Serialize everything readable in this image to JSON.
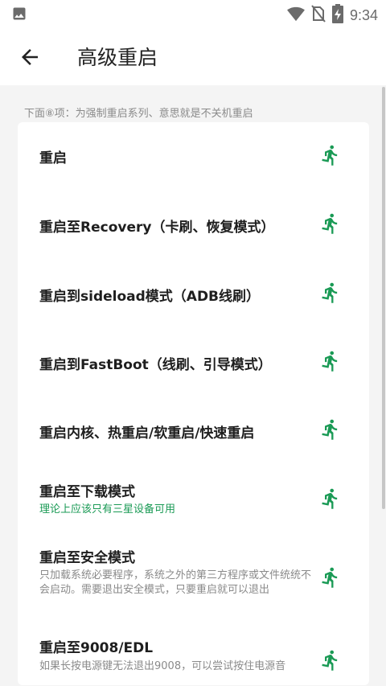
{
  "status_bar": {
    "time": "9:34",
    "icons": [
      "image-icon",
      "wifi-icon",
      "no-sim-icon",
      "battery-charging-icon"
    ]
  },
  "app_bar": {
    "title": "高级重启",
    "back_icon": "arrow-back-icon"
  },
  "hint": "下面⑧项：为强制重启系列、意思就是不关机重启",
  "colors": {
    "accent": "#1a9a55",
    "background": "#f4f4f4",
    "card": "#ffffff"
  },
  "items": [
    {
      "title": "重启",
      "desc": "",
      "icon": "run-icon"
    },
    {
      "title": "重启至Recovery（卡刷、恢复模式）",
      "desc": "",
      "icon": "run-icon"
    },
    {
      "title": "重启到sideload模式（ADB线刷）",
      "desc": "",
      "icon": "run-icon"
    },
    {
      "title": "重启到FastBoot（线刷、引导模式）",
      "desc": "",
      "icon": "run-icon"
    },
    {
      "title": "重启内核、热重启/软重启/快速重启",
      "desc": "",
      "icon": "run-icon"
    },
    {
      "title": "重启至下载模式",
      "desc": "理论上应该只有三星设备可用",
      "icon": "run-icon"
    },
    {
      "title": "重启至安全模式",
      "desc": "只加载系统必要程序，系统之外的第三方程序或文件统统不会启动。需要退出安全模式，只要重启就可以退出",
      "icon": "run-icon"
    },
    {
      "title": "重启至9008/EDL",
      "desc": "如果长按电源键无法退出9008，可以尝试按住电源音",
      "icon": "run-icon"
    }
  ]
}
